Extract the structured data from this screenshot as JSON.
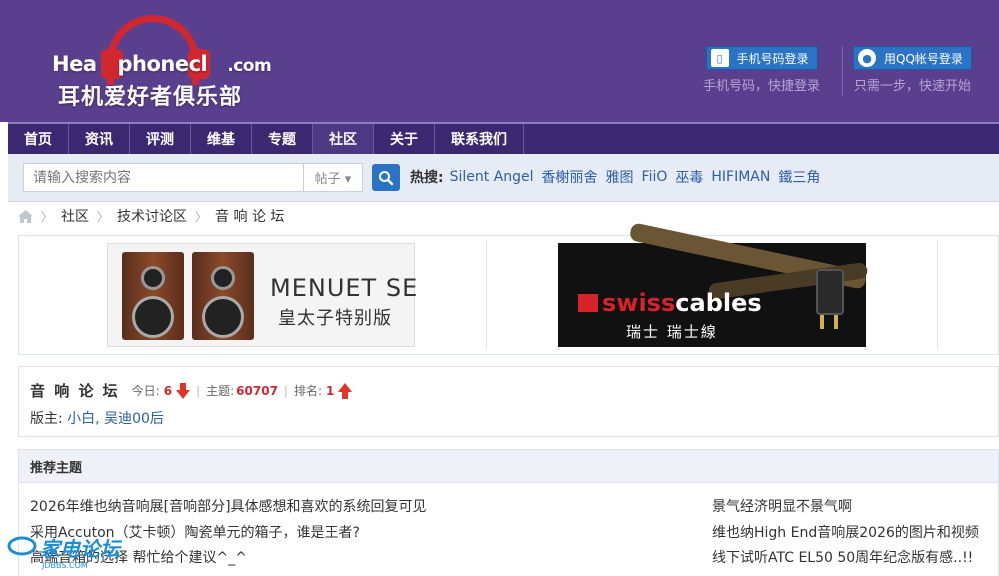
{
  "logo": {
    "en_prefix": "Hea",
    "en_mid": "phonecl",
    "en_suffix": ".com",
    "cn": "耳机爱好者俱乐部"
  },
  "login": {
    "phone": {
      "label": "手机号码登录",
      "sub": "手机号码，快捷登录"
    },
    "qq": {
      "label": "用QQ帐号登录",
      "sub": "只需一步，快速开始"
    }
  },
  "nav": [
    "首页",
    "资讯",
    "评测",
    "维基",
    "专题",
    "社区",
    "关于",
    "联系我们"
  ],
  "search": {
    "placeholder": "请输入搜索内容",
    "type": "帖子 ▾",
    "hot_label": "热搜:",
    "hot": [
      "Silent Angel",
      "香榭丽舍",
      "雅图",
      "FiiO",
      "巫毒",
      "HIFIMAN",
      "鐵三角"
    ]
  },
  "breadcrumb": [
    "社区",
    "技术讨论区",
    "音 响 论 坛"
  ],
  "ads": {
    "ad1": {
      "line1": "MENUET SE",
      "line2": "皇太子特别版"
    },
    "ad2": {
      "brand_red": "swiss",
      "brand_white": "cables",
      "line2": "瑞士 瑞士線"
    }
  },
  "forum": {
    "title": "音 响 论 坛",
    "today_label": "今日:",
    "today": "6",
    "topics_label": "主题:",
    "topics": "60707",
    "rank_label": "排名:",
    "rank": "1",
    "mods_label": "版主:",
    "mods": "小白, 吴迪00后"
  },
  "recommend": {
    "title": "推荐主题",
    "left": [
      "2026年维也纳音响展[音响部分]具体感想和喜欢的系统回复可见",
      "采用Accuton（艾卡顿）陶瓷单元的箱子，谁是王者?",
      "高端音箱的选择 帮忙给个建议^_^"
    ],
    "right": [
      "景气经济明显不景气啊",
      "维也纳High End音响展2026的图片和视频",
      "线下试听ATC EL50 50周年纪念版有感..!!"
    ]
  },
  "watermark": {
    "text": "家电论坛",
    "sub": "JDBBS.COM"
  },
  "colors": {
    "header_bg": "#5b3f8f",
    "nav_bg": "#3c2870",
    "accent_blue": "#2b73c4",
    "accent_red": "#d2272f",
    "link": "#2d5fa3"
  }
}
